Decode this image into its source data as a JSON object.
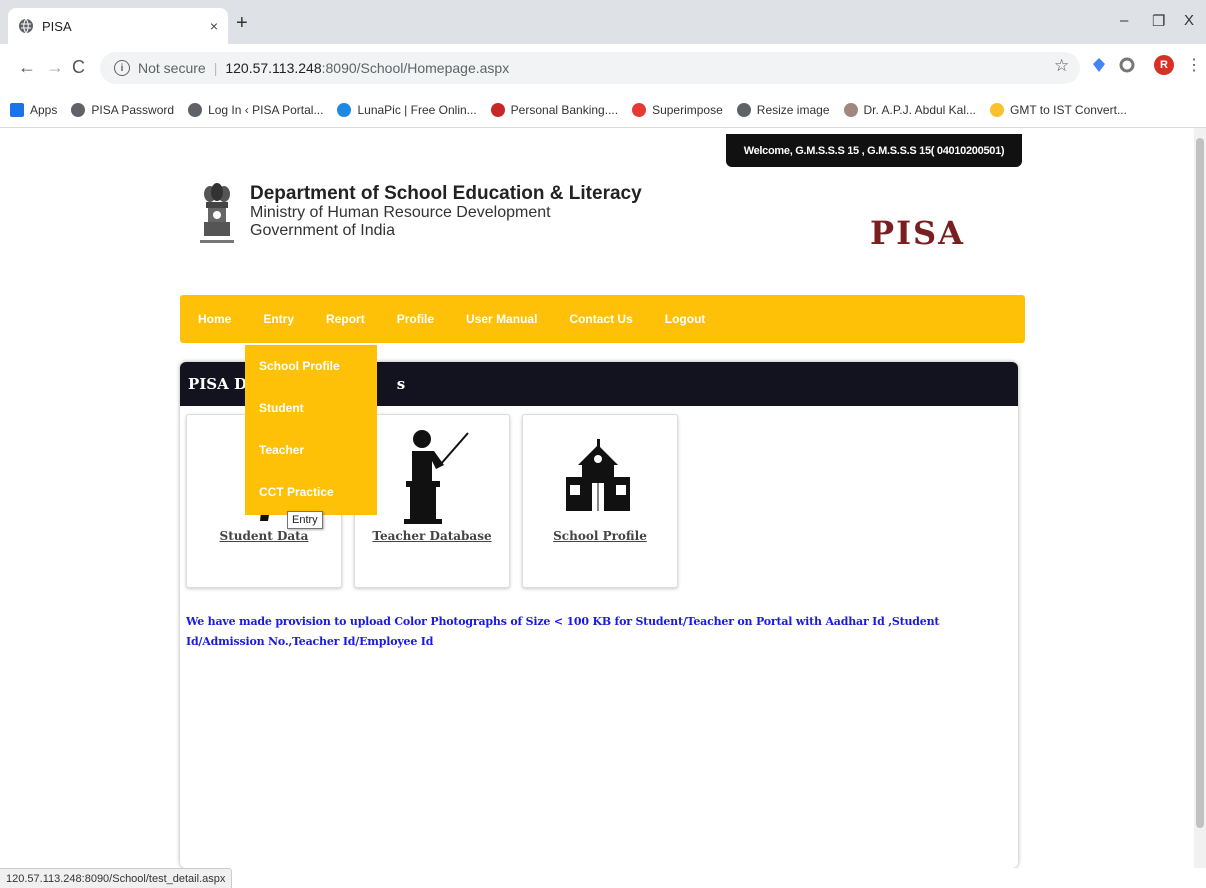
{
  "browser": {
    "tab_title": "PISA",
    "tab_close": "×",
    "new_tab": "+",
    "url_secure_label": "Not secure",
    "url_host": "120.57.113.248",
    "url_path": ":8090/School/Homepage.aspx",
    "bookmarks": [
      {
        "label": "Apps",
        "icon": "apps-icon",
        "color": "#1a73e8"
      },
      {
        "label": "PISA Password",
        "icon": "globe-icon",
        "color": "#5f6368"
      },
      {
        "label": "Log In ‹ PISA Portal...",
        "icon": "globe-icon",
        "color": "#5f6368"
      },
      {
        "label": "LunaPic | Free Onlin...",
        "icon": "lunapic-icon",
        "color": "#1e88e5"
      },
      {
        "label": "Personal Banking....",
        "icon": "bank-icon",
        "color": "#c62828"
      },
      {
        "label": "Superimpose",
        "icon": "superimpose-icon",
        "color": "#e53935"
      },
      {
        "label": "Resize image",
        "icon": "globe-icon",
        "color": "#5f6368"
      },
      {
        "label": "Dr. A.P.J. Abdul Kal...",
        "icon": "portrait-icon",
        "color": "#a1887f"
      },
      {
        "label": "GMT to IST Convert...",
        "icon": "chrome-icon",
        "color": "#fbc02d"
      }
    ],
    "status_url": "120.57.113.248:8090/School/test_detail.aspx",
    "profile_initial": "R"
  },
  "page": {
    "welcome": "Welcome,  G.M.S.S.S 15 , G.M.S.S.S 15( 04010200501)",
    "dept_line1": "Department of School Education & Literacy",
    "dept_line2": "Ministry of Human Resource Development",
    "dept_line3": "Government of India",
    "logo": "PISA",
    "menu": [
      "Home",
      "Entry",
      "Report",
      "Profile",
      "User Manual",
      "Contact Us",
      "Logout"
    ],
    "dropdown": [
      "School Profile",
      "Student",
      "Teacher",
      "CCT Practice"
    ],
    "tooltip": "Entry",
    "panel_title_left": "PISA Da",
    "panel_title_right": "s",
    "cards": [
      "Student Data",
      "Teacher Database",
      "School Profile"
    ],
    "notice": "We have made provision to upload Color Photographs of Size < 100 KB for Student/Teacher on Portal with Aadhar Id ,Student Id/Admission No.,Teacher Id/Employee Id"
  },
  "colors": {
    "menu_bg": "#ffc107",
    "panel_head_bg": "#13131f",
    "notice_text": "#1a1ae6",
    "logo_text": "#7a1f1f"
  }
}
